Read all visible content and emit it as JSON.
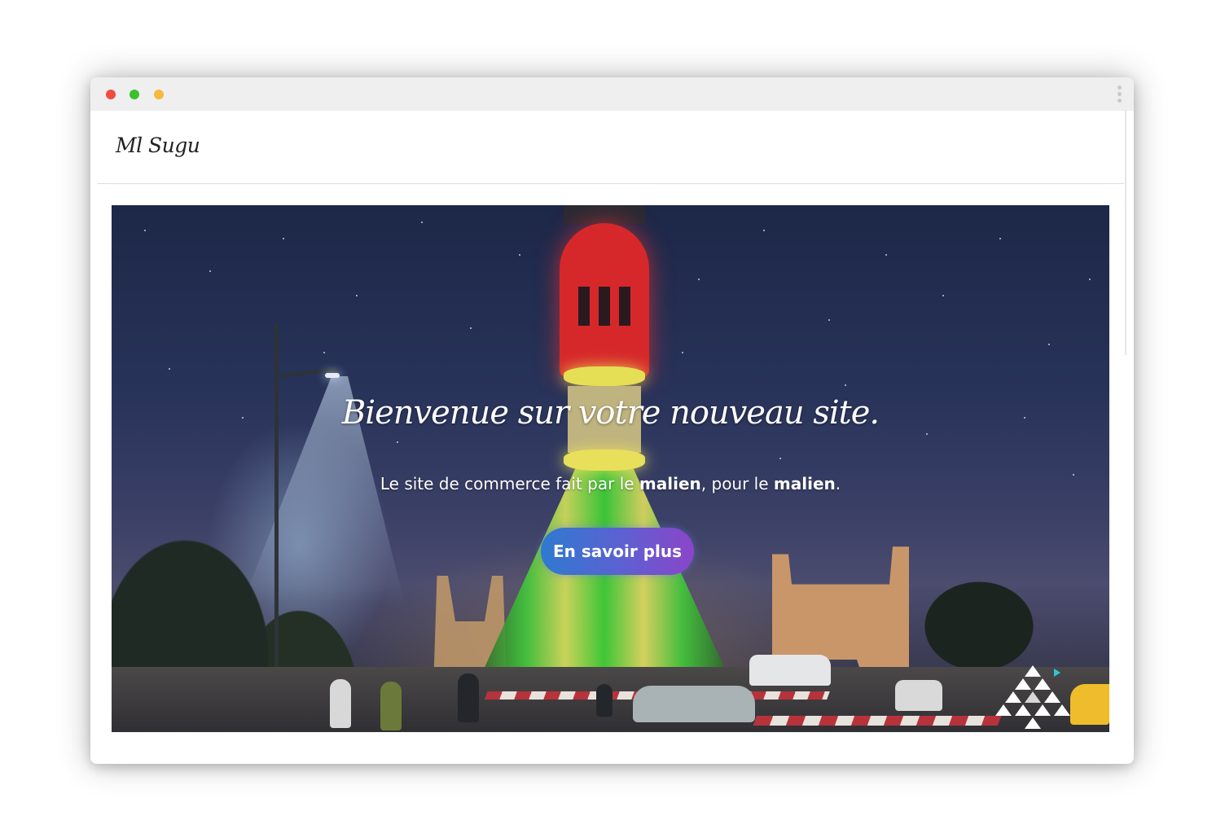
{
  "site": {
    "brand": "Ml Sugu"
  },
  "hero": {
    "title": "Bienvenue sur votre nouveau site.",
    "subtitle_parts": {
      "p1": "Le site de commerce fait par le ",
      "b1": "malien",
      "p2": ", pour le ",
      "b2": "malien",
      "p3": "."
    },
    "cta_label": "En savoir plus"
  },
  "colors": {
    "dot_close": "#f24b3f",
    "dot_maximize": "#3bc12d",
    "dot_minimize": "#f6b93b",
    "cta_gradient_start": "#2e7ad0",
    "cta_gradient_end": "#8b45c9"
  },
  "icons": [
    "window-close-dot",
    "window-maximize-dot",
    "window-minimize-dot",
    "more-vertical-icon",
    "triangle-logo-icon"
  ]
}
